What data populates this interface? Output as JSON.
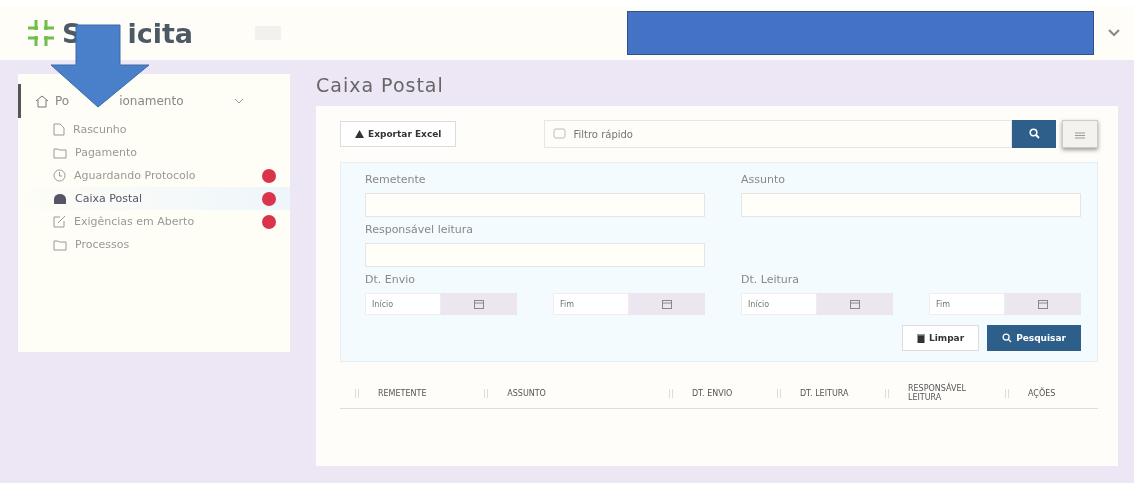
{
  "header": {
    "logo_parts": [
      "S",
      "icita"
    ],
    "redacted": true
  },
  "annotation": {
    "kind": "arrow"
  },
  "sidebar": {
    "section": {
      "label_parts": [
        "Po",
        "ionamento"
      ],
      "expanded": true
    },
    "items": [
      {
        "label": "Rascunho",
        "kind": "file",
        "badge": false,
        "selected": false
      },
      {
        "label": "Pagamento",
        "kind": "folder",
        "badge": false,
        "selected": false
      },
      {
        "label": "Aguardando Protocolo",
        "kind": "clock",
        "badge": true,
        "selected": false
      },
      {
        "label": "Caixa Postal",
        "kind": "inbox",
        "badge": true,
        "selected": true
      },
      {
        "label": "Exigências em Aberto",
        "kind": "edit",
        "badge": true,
        "selected": false
      },
      {
        "label": "Processos",
        "kind": "folder",
        "badge": false,
        "selected": false
      }
    ]
  },
  "page": {
    "title": "Caixa Postal",
    "toolbar": {
      "export": "Exportar Excel",
      "quick_filter": {
        "placeholder": "Filtro rápido"
      }
    },
    "filters": {
      "remetente": "Remetente",
      "assunto": "Assunto",
      "responsavel": "Responsável leitura",
      "dt_envio": {
        "label": "Dt. Envio",
        "start": {
          "placeholder": "Início"
        },
        "end": {
          "placeholder": "Fim"
        }
      },
      "dt_leitura": {
        "label": "Dt. Leitura",
        "start": {
          "placeholder": "Início"
        },
        "end": {
          "placeholder": "Fim"
        }
      },
      "clear": "Limpar",
      "search": "Pesquisar"
    },
    "table": {
      "columns": [
        "REMETENTE",
        "ASSUNTO",
        "DT. ENVIO",
        "DT. LEITURA",
        "RESPONSÁVEL LEITURA",
        "AÇÕES"
      ]
    }
  }
}
